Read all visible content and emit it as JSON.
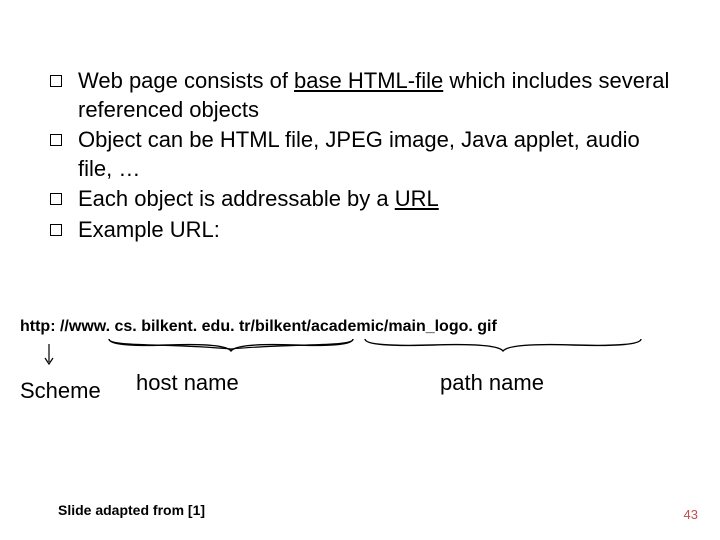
{
  "bullets": [
    {
      "pre": "Web page consists of ",
      "u": "base HTML-file",
      "post": " which includes several referenced objects"
    },
    {
      "pre": "Object can be HTML file, JPEG image, Java applet, audio file, …",
      "u": "",
      "post": ""
    },
    {
      "pre": "Each object is addressable by a ",
      "u": "URL",
      "post": ""
    },
    {
      "pre": "Example URL:",
      "u": "",
      "post": ""
    }
  ],
  "url": "http: //www. cs. bilkent. edu. tr/bilkent/academic/main_logo. gif",
  "labels": {
    "scheme": "Scheme",
    "host": "host name",
    "path": "path name"
  },
  "footer": "Slide adapted from [1]",
  "pageNumber": "43"
}
